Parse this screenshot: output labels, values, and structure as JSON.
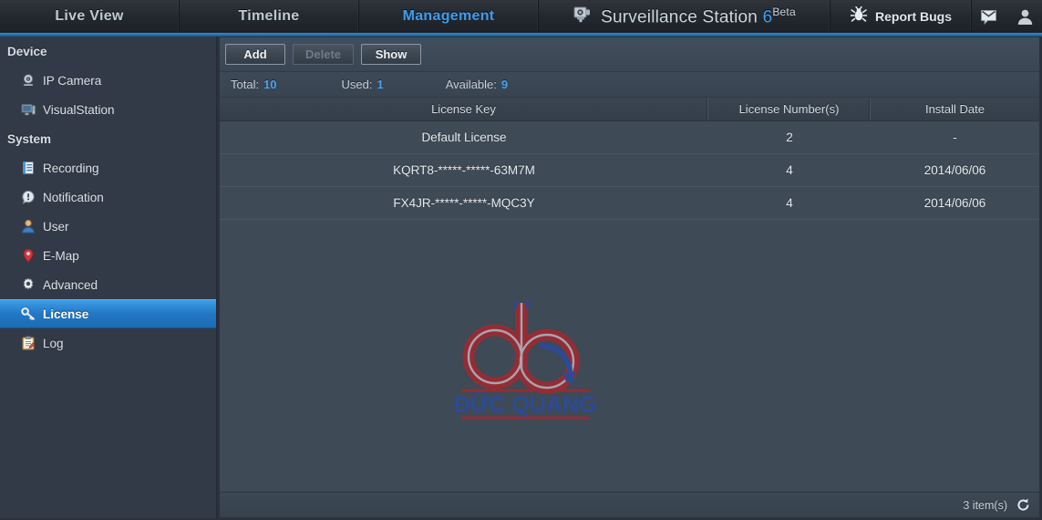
{
  "header": {
    "tabs": [
      {
        "label": "Live View",
        "active": false
      },
      {
        "label": "Timeline",
        "active": false
      },
      {
        "label": "Management",
        "active": true
      }
    ],
    "brand": {
      "name": "Surveillance Station",
      "version": "6",
      "beta": "Beta",
      "icon": "camera-icon"
    },
    "report_bugs": {
      "label": "Report Bugs",
      "icon": "bug-icon"
    },
    "icons": [
      "mail-icon",
      "user-account-icon"
    ]
  },
  "sidebar": {
    "groups": [
      {
        "title": "Device",
        "items": [
          {
            "label": "IP Camera",
            "icon": "ip-camera-icon",
            "active": false
          },
          {
            "label": "VisualStation",
            "icon": "visualstation-icon",
            "active": false
          }
        ]
      },
      {
        "title": "System",
        "items": [
          {
            "label": "Recording",
            "icon": "recording-icon",
            "active": false
          },
          {
            "label": "Notification",
            "icon": "notification-icon",
            "active": false
          },
          {
            "label": "User",
            "icon": "user-icon",
            "active": false
          },
          {
            "label": "E-Map",
            "icon": "map-pin-icon",
            "active": false
          },
          {
            "label": "Advanced",
            "icon": "gear-icon",
            "active": false
          },
          {
            "label": "License",
            "icon": "key-icon",
            "active": true
          },
          {
            "label": "Log",
            "icon": "log-icon",
            "active": false
          }
        ]
      }
    ]
  },
  "toolbar": {
    "add_label": "Add",
    "delete_label": "Delete",
    "show_label": "Show"
  },
  "summary": {
    "total_label": "Total:",
    "total_value": "10",
    "used_label": "Used:",
    "used_value": "1",
    "available_label": "Available:",
    "available_value": "9"
  },
  "table": {
    "columns": [
      {
        "label": "License Key"
      },
      {
        "label": "License Number(s)"
      },
      {
        "label": "Install Date"
      }
    ],
    "rows": [
      {
        "key": "Default License",
        "number": "2",
        "date": "-"
      },
      {
        "key": "KQRT8-*****-*****-63M7M",
        "number": "4",
        "date": "2014/06/06"
      },
      {
        "key": "FX4JR-*****-*****-MQC3Y",
        "number": "4",
        "date": "2014/06/06"
      }
    ]
  },
  "footer": {
    "item_count": "3 item(s)",
    "refresh_icon": "refresh-icon"
  },
  "watermark": {
    "text": "ĐỨC QUANG",
    "logo": "dq-logo",
    "colors": {
      "red": "#9b2b33",
      "blue": "#2b4a9b"
    }
  },
  "colors": {
    "accent_blue": "#3e9ef0",
    "sidebar_bg": "#333a47",
    "panel_bg": "#3e4a56",
    "header_bg": "#22262d"
  }
}
